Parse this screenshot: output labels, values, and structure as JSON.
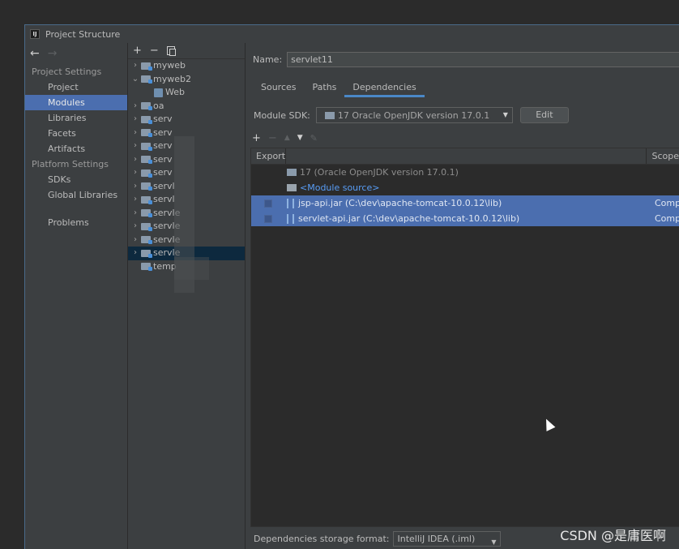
{
  "window": {
    "title": "Project Structure",
    "app_icon_text": "IJ"
  },
  "nav": {
    "back_icon": "arrow-left-icon",
    "forward_icon": "arrow-right-icon",
    "sections": [
      {
        "title": "Project Settings",
        "items": [
          "Project",
          "Modules",
          "Libraries",
          "Facets",
          "Artifacts"
        ]
      },
      {
        "title": "Platform Settings",
        "items": [
          "SDKs",
          "Global Libraries"
        ]
      }
    ],
    "problems": "Problems",
    "selected": "Modules"
  },
  "tree": {
    "toolbar": {
      "add": "+",
      "remove": "−"
    },
    "rows": [
      {
        "label": "myweb",
        "expanded": false,
        "type": "module"
      },
      {
        "label": "myweb2",
        "expanded": true,
        "type": "module"
      },
      {
        "label": "Web",
        "expanded": null,
        "type": "facet"
      },
      {
        "label": "oa",
        "expanded": false,
        "type": "module"
      },
      {
        "label": "serv",
        "expanded": false,
        "type": "module"
      },
      {
        "label": "serv",
        "expanded": false,
        "type": "module"
      },
      {
        "label": "serv",
        "expanded": false,
        "type": "module"
      },
      {
        "label": "serv",
        "expanded": false,
        "type": "module"
      },
      {
        "label": "serv",
        "expanded": false,
        "type": "module"
      },
      {
        "label": "servl",
        "expanded": false,
        "type": "module"
      },
      {
        "label": "servl",
        "expanded": false,
        "type": "module"
      },
      {
        "label": "servle",
        "expanded": false,
        "type": "module"
      },
      {
        "label": "servle",
        "expanded": false,
        "type": "module"
      },
      {
        "label": "servle",
        "expanded": false,
        "type": "module"
      },
      {
        "label": "servle",
        "expanded": false,
        "type": "module",
        "selected": true
      },
      {
        "label": "temp",
        "expanded": null,
        "type": "module"
      }
    ]
  },
  "module": {
    "name_label": "Name:",
    "name_value": "servlet11",
    "tabs": [
      "Sources",
      "Paths",
      "Dependencies"
    ],
    "active_tab": "Dependencies",
    "sdk_label": "Module SDK:",
    "sdk_value": "17 Oracle OpenJDK version 17.0.1",
    "edit_label": "Edit"
  },
  "dependencies": {
    "toolbar": {
      "add": "+",
      "remove": "−",
      "up": "▲",
      "down": "▼",
      "edit": "✎"
    },
    "columns": {
      "export": "Export",
      "scope": "Scope"
    },
    "rows": [
      {
        "name_main": "17",
        "name_detail": "(Oracle OpenJDK version 17.0.1)",
        "kind": "sdk",
        "scope": "",
        "selected": false
      },
      {
        "name_main": "<Module source>",
        "name_detail": "",
        "kind": "source",
        "scope": "",
        "selected": false
      },
      {
        "name_main": "jsp-api.jar",
        "name_detail": "(C:\\dev\\apache-tomcat-10.0.12\\lib)",
        "kind": "jar",
        "scope": "Compi",
        "selected": true
      },
      {
        "name_main": "servlet-api.jar",
        "name_detail": "(C:\\dev\\apache-tomcat-10.0.12\\lib)",
        "kind": "jar",
        "scope": "Compi",
        "selected": true
      }
    ],
    "format_label": "Dependencies storage format:",
    "format_value": "IntelliJ IDEA (.iml)"
  },
  "watermark": "CSDN @是庸医啊"
}
